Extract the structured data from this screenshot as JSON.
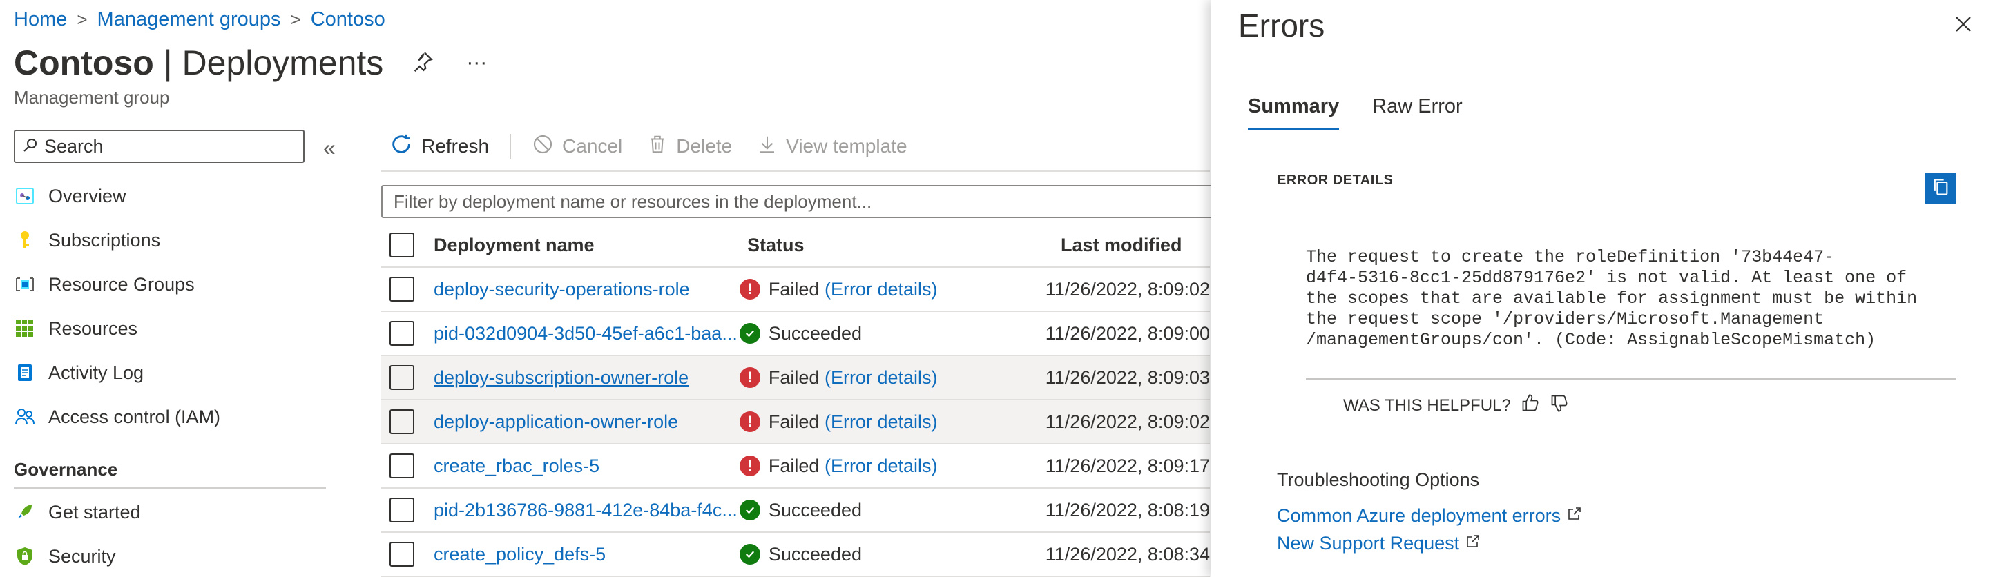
{
  "breadcrumb": {
    "home": "Home",
    "management_groups": "Management groups",
    "contoso": "Contoso",
    "separator": ">"
  },
  "header": {
    "title_bold": "Contoso",
    "title_rest": " | Deployments",
    "subtitle": "Management group",
    "more": "···"
  },
  "sidebar": {
    "search_placeholder": "Search",
    "collapse": "«",
    "items": [
      {
        "label": "Overview",
        "icon": "overview-icon"
      },
      {
        "label": "Subscriptions",
        "icon": "key-icon"
      },
      {
        "label": "Resource Groups",
        "icon": "resource-groups-icon"
      },
      {
        "label": "Resources",
        "icon": "grid-icon"
      },
      {
        "label": "Activity Log",
        "icon": "activity-log-icon"
      },
      {
        "label": "Access control (IAM)",
        "icon": "people-icon"
      }
    ],
    "group": "Governance",
    "group_items": [
      {
        "label": "Get started",
        "icon": "rocket-icon"
      },
      {
        "label": "Security",
        "icon": "shield-icon"
      }
    ]
  },
  "toolbar": {
    "refresh": "Refresh",
    "cancel": "Cancel",
    "delete": "Delete",
    "view_template": "View template"
  },
  "filter": {
    "placeholder": "Filter by deployment name or resources in the deployment..."
  },
  "table": {
    "columns": {
      "name": "Deployment name",
      "status": "Status",
      "modified": "Last modified"
    },
    "error_link": "(Error details)",
    "rows": [
      {
        "name": "deploy-security-operations-role",
        "status": "Failed",
        "modified": "11/26/2022, 8:09:02"
      },
      {
        "name": "pid-032d0904-3d50-45ef-a6c1-baa...",
        "status": "Succeeded",
        "modified": "11/26/2022, 8:09:00"
      },
      {
        "name": "deploy-subscription-owner-role",
        "status": "Failed",
        "modified": "11/26/2022, 8:09:03"
      },
      {
        "name": "deploy-application-owner-role",
        "status": "Failed",
        "modified": "11/26/2022, 8:09:02"
      },
      {
        "name": "create_rbac_roles-5",
        "status": "Failed",
        "modified": "11/26/2022, 8:09:17"
      },
      {
        "name": "pid-2b136786-9881-412e-84ba-f4c...",
        "status": "Succeeded",
        "modified": "11/26/2022, 8:08:19"
      },
      {
        "name": "create_policy_defs-5",
        "status": "Succeeded",
        "modified": "11/26/2022, 8:08:34"
      }
    ]
  },
  "panel": {
    "title": "Errors",
    "tabs": [
      "Summary",
      "Raw Error"
    ],
    "error_details_label": "ERROR DETAILS",
    "error_text": "The request to create the roleDefinition '73b44e47-\nd4f4-5316-8cc1-25dd879176e2' is not valid. At least one of\nthe scopes that are available for assignment must be within\nthe request scope '/providers/Microsoft.Management\n/managementGroups/con'. (Code: AssignableScopeMismatch)",
    "helpful": "WAS THIS HELPFUL?",
    "troubleshooting": "Troubleshooting Options",
    "links": [
      "Common Azure deployment errors",
      "New Support Request"
    ]
  },
  "colors": {
    "accent": "#0f6cbd",
    "failed": "#d13438",
    "succeeded": "#107c10"
  }
}
